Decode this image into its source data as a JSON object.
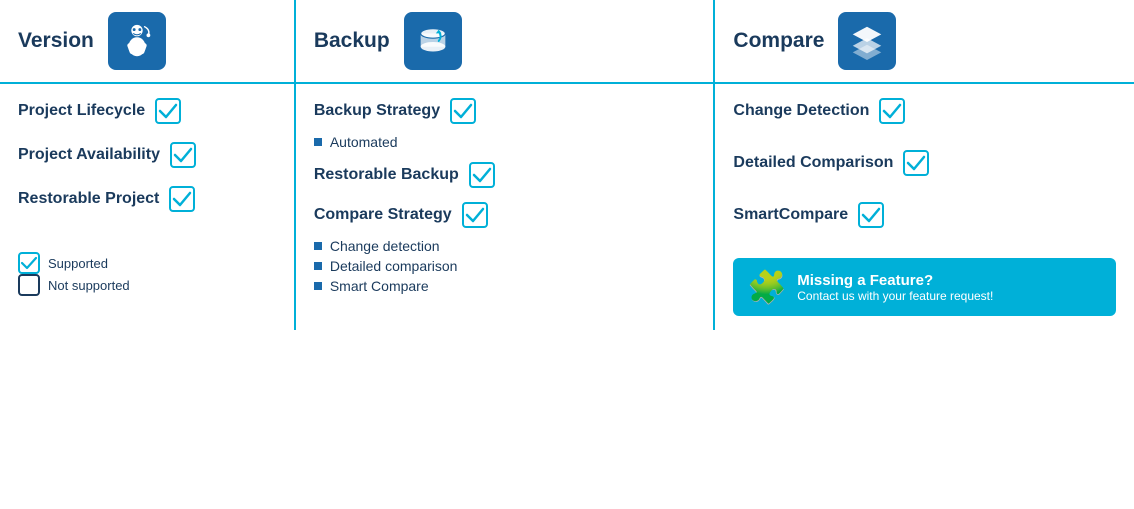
{
  "header": {
    "version_label": "Version",
    "backup_label": "Backup",
    "compare_label": "Compare"
  },
  "version_features": [
    {
      "label": "Project Lifecycle",
      "supported": true
    },
    {
      "label": "Project Availability",
      "supported": true
    },
    {
      "label": "Restorable Project",
      "supported": true
    }
  ],
  "backup_features": [
    {
      "label": "Backup Strategy",
      "supported": true,
      "sub_items": [
        "Automated"
      ]
    },
    {
      "label": "Restorable Backup",
      "supported": true,
      "sub_items": []
    },
    {
      "label": "Compare Strategy",
      "supported": true,
      "sub_items": [
        "Change detection",
        "Detailed comparison",
        "Smart Compare"
      ]
    }
  ],
  "compare_features": [
    {
      "label": "Change Detection",
      "supported": true
    },
    {
      "label": "Detailed Comparison",
      "supported": true
    },
    {
      "label": "SmartCompare",
      "supported": true
    }
  ],
  "legend": {
    "supported_label": "Supported",
    "not_supported_label": "Not supported"
  },
  "missing_feature": {
    "title": "Missing a Feature?",
    "subtitle": "Contact us with your feature request!"
  }
}
